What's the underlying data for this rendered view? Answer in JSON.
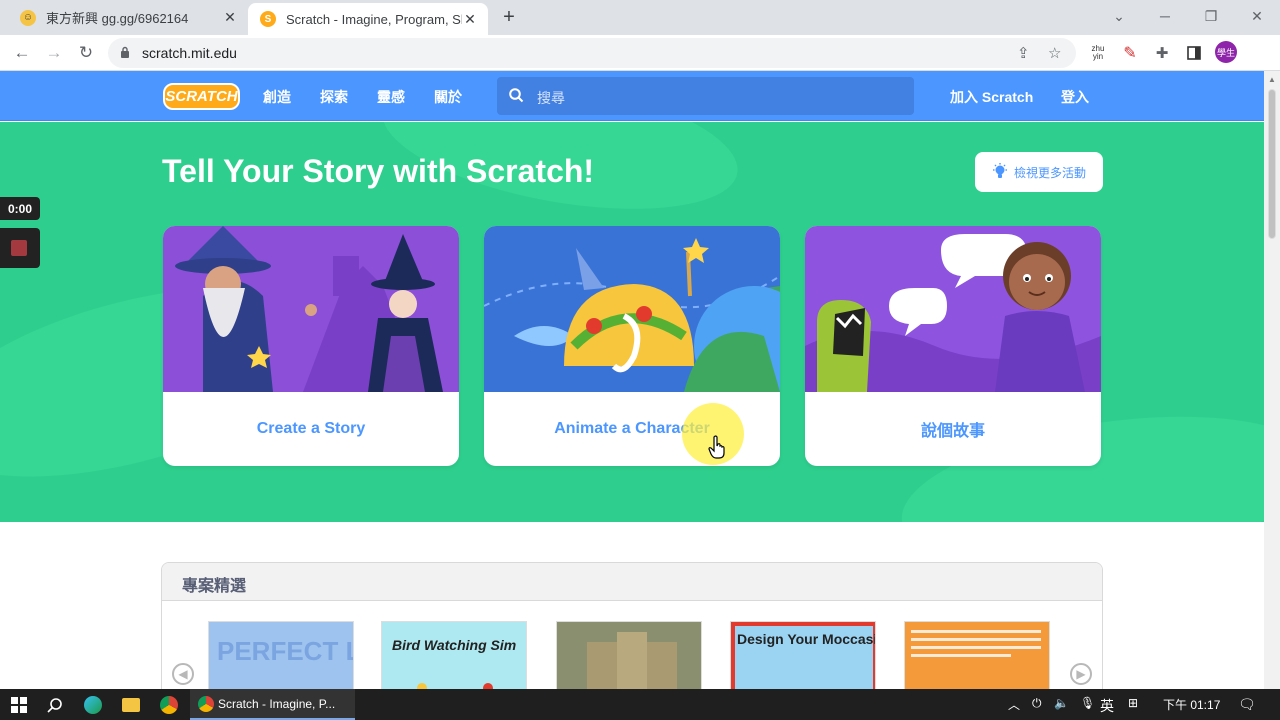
{
  "browser": {
    "tabs": [
      {
        "title": "東方新興 gg.gg/6962164",
        "favicon": "emoji-favicon",
        "active": false
      },
      {
        "title": "Scratch - Imagine, Program, Sh",
        "favicon": "scratch-favicon",
        "active": true
      }
    ],
    "new_tab": "+",
    "url": "scratch.mit.edu",
    "ext_zhuyin": "zhu\nyin",
    "profile": "學生"
  },
  "scratch": {
    "logo": "SCRATCH",
    "nav": [
      "創造",
      "探索",
      "靈感",
      "關於"
    ],
    "search_placeholder": "搜尋",
    "join": "加入 Scratch",
    "signin": "登入",
    "hero_title": "Tell Your Story with Scratch!",
    "more_activities": "檢視更多活動",
    "cards": [
      {
        "label": "Create a Story"
      },
      {
        "label": "Animate a Character"
      },
      {
        "label": "說個故事"
      }
    ],
    "featured_title": "專案精選",
    "featured_thumbs": [
      {
        "title": "PERFECT LANDING",
        "bg": "#9ec3ef"
      },
      {
        "title": "Bird Watching Sim",
        "bg": "#aee8f0"
      },
      {
        "title": "",
        "bg": "#7b7a60"
      },
      {
        "title": "Design Your Moccasins",
        "bg": "#e23b2e"
      },
      {
        "title": "",
        "bg": "#f59a3a"
      }
    ]
  },
  "recorder": {
    "time": "0:00"
  },
  "taskbar": {
    "active_window": "Scratch - Imagine, P...",
    "ime": "英",
    "time": "下午 01:17"
  },
  "colors": {
    "scratch_blue": "#4c97ff",
    "hero_green": "#2ecf8e",
    "logo_orange": "#ffab19"
  }
}
